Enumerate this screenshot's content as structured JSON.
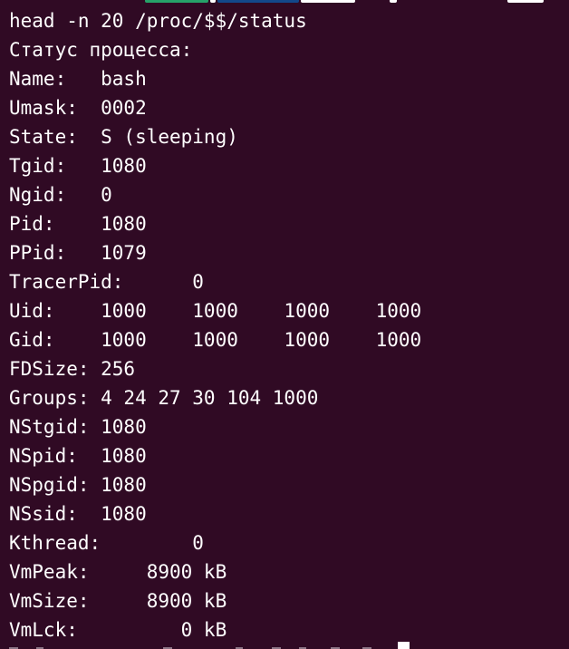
{
  "terminal": {
    "background_color": "#300a24",
    "text_color": "#ffffff",
    "command": "head -n 20 /proc/$$/status",
    "lines": [
      "Статус процесса:",
      "Name:   bash",
      "Umask:  0002",
      "State:  S (sleeping)",
      "Tgid:   1080",
      "Ngid:   0",
      "Pid:    1080",
      "PPid:   1079",
      "TracerPid:      0",
      "Uid:    1000    1000    1000    1000",
      "Gid:    1000    1000    1000    1000",
      "FDSize: 256",
      "Groups: 4 24 27 30 104 1000",
      "NStgid: 1080",
      "NSpid:  1080",
      "NSpgid: 1080",
      "NSsid:  1080",
      "Kthread:        0",
      "VmPeak:     8900 kB",
      "VmSize:     8900 kB",
      "VmLck:         0 kB"
    ]
  }
}
